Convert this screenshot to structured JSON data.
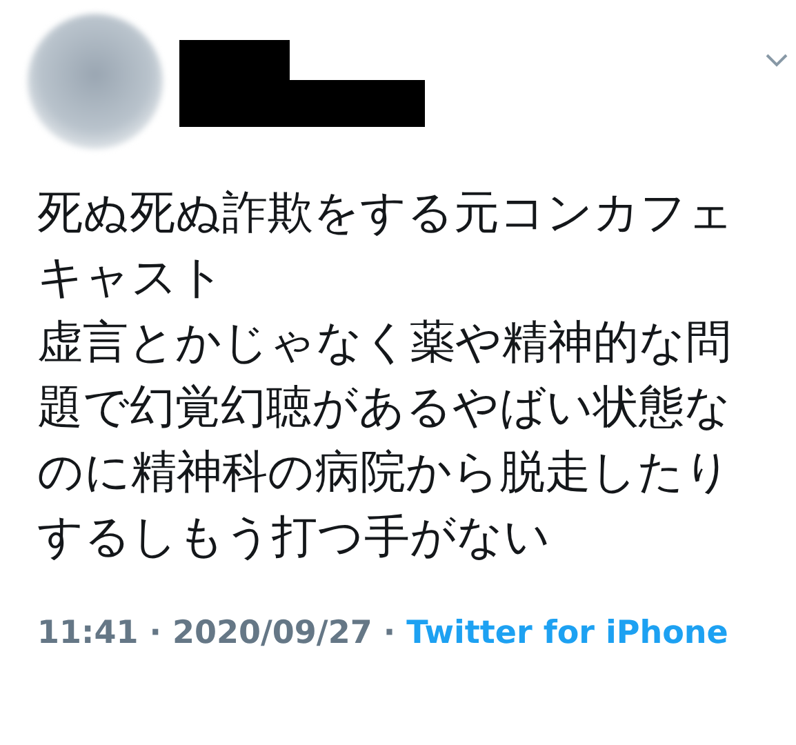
{
  "tweet": {
    "text_paragraphs": [
      "死ぬ死ぬ詐欺をする元コンカフェキャスト",
      "虚言とかじゃなく薬や精神的な問題で幻覚幻聴があるやばい状態なのに精神科の病院から脱走したりするしもう打つ手がない"
    ],
    "time": "11:41",
    "separator_1": "·",
    "date": "2020/09/27",
    "separator_2": "·",
    "source": "Twitter for iPhone"
  }
}
